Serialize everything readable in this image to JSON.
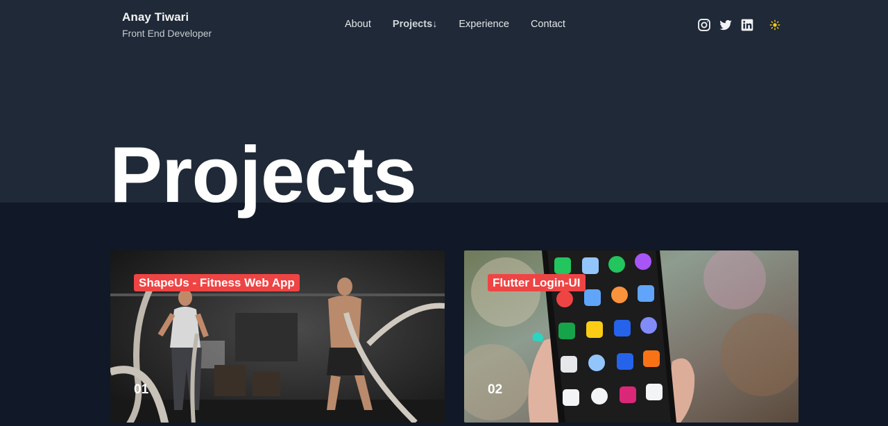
{
  "header": {
    "name": "Anay Tiwari",
    "role": "Front End Developer"
  },
  "nav": {
    "items": [
      "About",
      "Projects↓",
      "Experience",
      "Contact"
    ],
    "active_index": 1
  },
  "socials": [
    "instagram-icon",
    "twitter-icon",
    "linkedin-icon"
  ],
  "theme_icon": "sun-icon",
  "page": {
    "title": "Projects"
  },
  "projects": [
    {
      "tag": "ShapeUs - Fitness Web App",
      "number": "01"
    },
    {
      "tag": "Flutter Login-UI",
      "number": "02"
    }
  ],
  "colors": {
    "header_bg": "#1f2937",
    "body_bg": "#111827",
    "tag_bg": "#ef4444",
    "sun": "#facc15"
  }
}
